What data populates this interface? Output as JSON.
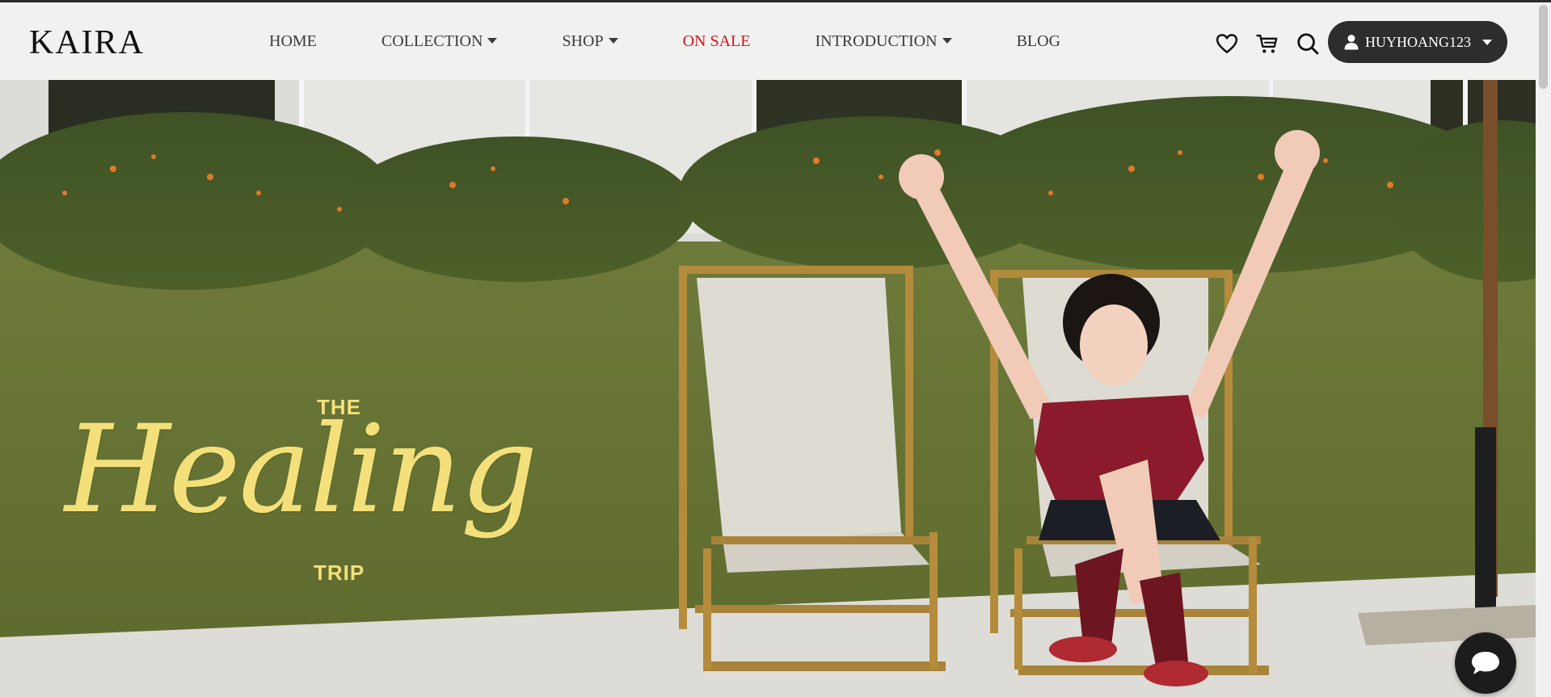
{
  "header": {
    "logo": "KAIRA",
    "nav": [
      {
        "label": "HOME",
        "has_dropdown": false
      },
      {
        "label": "COLLECTION",
        "has_dropdown": true
      },
      {
        "label": "SHOP",
        "has_dropdown": true
      },
      {
        "label": "ON SALE",
        "has_dropdown": false,
        "color": "#d4141c"
      },
      {
        "label": "INTRODUCTION",
        "has_dropdown": true
      },
      {
        "label": "BLOG",
        "has_dropdown": false
      }
    ],
    "icons": [
      "heart-icon",
      "cart-icon",
      "search-icon"
    ],
    "user": {
      "username": "HUYHOANG123",
      "icon": "user-icon"
    }
  },
  "hero": {
    "line1": "THE",
    "title": "Healing",
    "line2": "TRIP",
    "text_color": "#f4e07a"
  },
  "chat": {
    "icon": "chat-bubble-icon"
  },
  "colors": {
    "header_bg": "#f1f1ef",
    "accent_sale": "#d4141c",
    "user_button_bg": "#2d2d2d"
  }
}
